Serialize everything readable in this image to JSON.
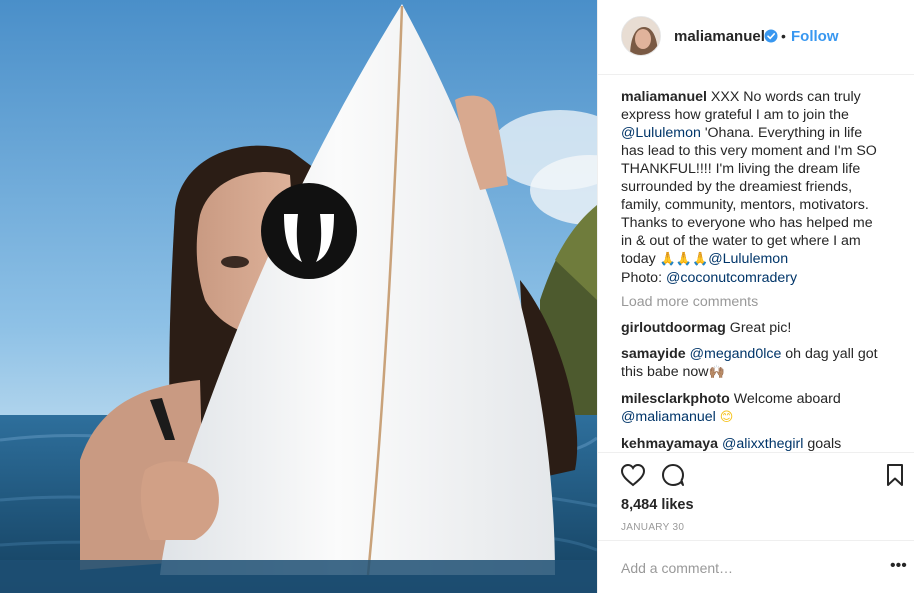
{
  "post": {
    "username": "maliamanuel",
    "follow_label": "Follow",
    "dot": "•",
    "caption_lines": [
      "XXX No words can truly",
      "express how grateful I am to join the",
      "@Lululemon",
      " 'Ohana. Everything in life",
      "has lead to this very moment and I'm SO",
      "THANKFUL!!!! I'm living the dream life",
      "surrounded by the dreamiest friends,",
      "family, community, mentors, motivators.",
      "Thanks to everyone who has helped me",
      "in & out of the water to get where I am",
      "today ",
      "🙏🙏🙏",
      "@Lululemon",
      "Photo: ",
      "@coconutcomradery"
    ],
    "load_more": "Load more comments",
    "likes": "8,484 likes",
    "date": "JANUARY 30",
    "add_comment_placeholder": "Add a comment…",
    "more": "•••"
  },
  "comments": [
    {
      "user": "girloutdoormag",
      "text": "Great pic!"
    },
    {
      "user": "samayide",
      "mention": "@megand0lce",
      "text": " oh dag yall got",
      "text2": "this babe now",
      "emoji": "🙌🏽"
    },
    {
      "user": "milesclarkphoto",
      "text": "Welcome aboard",
      "mention": "@maliamanuel",
      "emoji": "😊"
    },
    {
      "user": "kehmayamaya",
      "mention": "@alixxthegirl",
      "text": " goals"
    }
  ],
  "photo": {
    "board_logo": "lululemon-logo-icon"
  },
  "colors": {
    "link": "#003569",
    "follow": "#3897f0",
    "muted": "#999999",
    "text": "#262626"
  }
}
